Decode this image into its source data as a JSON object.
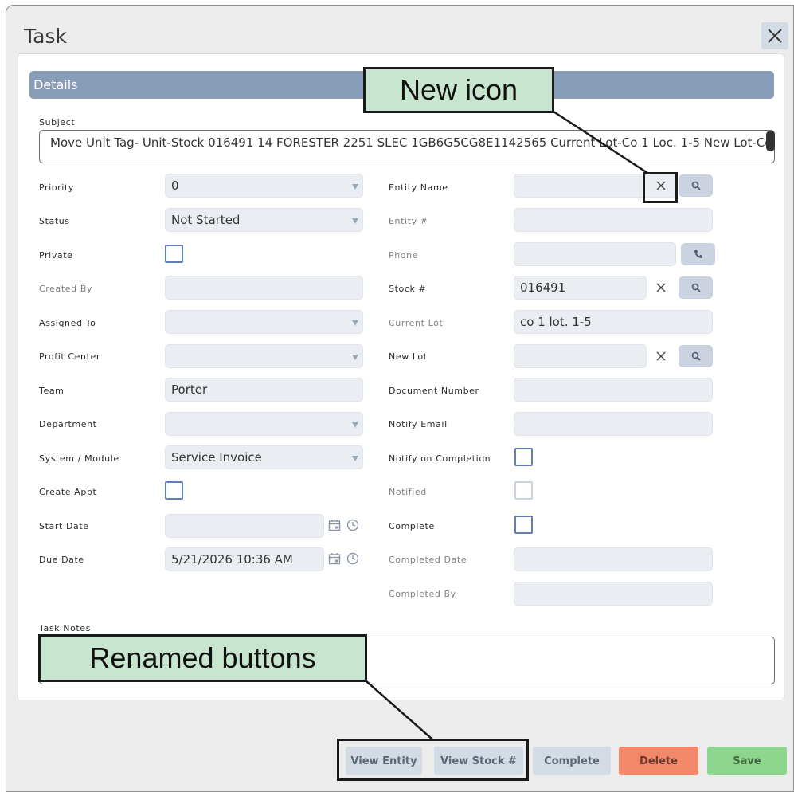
{
  "dialog": {
    "title": "Task"
  },
  "section": {
    "title": "Details"
  },
  "subject": {
    "label": "Subject",
    "value": "Move Unit Tag- Unit-Stock 016491 14 FORESTER 2251 SLEC 1GB6G5CG8E1142565 Current Lot-Co 1 Loc. 1-5 New Lot-Co"
  },
  "left": {
    "priority": {
      "label": "Priority",
      "value": "0"
    },
    "status": {
      "label": "Status",
      "value": "Not Started"
    },
    "private": {
      "label": "Private"
    },
    "created_by": {
      "label": "Created By",
      "value": ""
    },
    "assigned_to": {
      "label": "Assigned To",
      "value": ""
    },
    "profit_center": {
      "label": "Profit Center",
      "value": ""
    },
    "team": {
      "label": "Team",
      "value": "Porter"
    },
    "department": {
      "label": "Department",
      "value": ""
    },
    "system_module": {
      "label": "System / Module",
      "value": "Service Invoice"
    },
    "create_appt": {
      "label": "Create Appt"
    },
    "start_date": {
      "label": "Start Date",
      "value": ""
    },
    "due_date": {
      "label": "Due Date",
      "value": "5/21/2026 10:36 AM"
    }
  },
  "right": {
    "entity_name": {
      "label": "Entity Name",
      "value": ""
    },
    "entity_num": {
      "label": "Entity #",
      "value": ""
    },
    "phone": {
      "label": "Phone",
      "value": ""
    },
    "stock_num": {
      "label": "Stock #",
      "value": "016491"
    },
    "current_lot": {
      "label": "Current Lot",
      "value": "co 1 lot. 1-5"
    },
    "new_lot": {
      "label": "New Lot",
      "value": ""
    },
    "document_number": {
      "label": "Document Number",
      "value": ""
    },
    "notify_email": {
      "label": "Notify Email",
      "value": ""
    },
    "notify_on_completion": {
      "label": "Notify on Completion"
    },
    "notified": {
      "label": "Notified"
    },
    "complete": {
      "label": "Complete"
    },
    "completed_date": {
      "label": "Completed Date",
      "value": ""
    },
    "completed_by": {
      "label": "Completed By",
      "value": ""
    }
  },
  "notes": {
    "label": "Task Notes",
    "value": ""
  },
  "buttons": {
    "view_entity": "View Entity",
    "view_stock": "View Stock #",
    "complete": "Complete",
    "delete": "Delete",
    "save": "Save"
  },
  "annotations": {
    "new_icon": "New icon",
    "renamed_buttons": "Renamed buttons"
  },
  "icons": {
    "close": "close-icon",
    "clear": "x-icon",
    "search": "search-icon",
    "phone": "phone-icon",
    "calendar": "calendar-icon",
    "clock": "clock-icon",
    "dropdown": "chevron-down-icon"
  },
  "colors": {
    "section_bar": "#889db8",
    "field_bg": "#eaedf1",
    "checkbox_border": "#5f7fb5",
    "delete_button": "#f28769",
    "save_button": "#8ed58e",
    "callout_bg": "#c8e6cf"
  }
}
